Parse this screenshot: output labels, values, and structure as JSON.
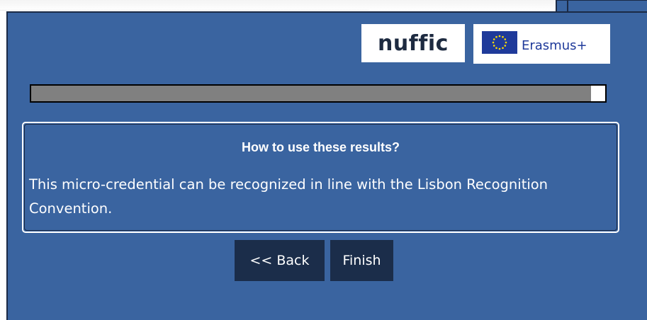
{
  "logos": {
    "nuffic": "nuffic",
    "erasmus": "Erasmus+"
  },
  "progress": {
    "fraction": 0.975,
    "fill_color": "#808080",
    "remaining_color": "#ffffff"
  },
  "results": {
    "title": "How to use these results?",
    "text": "This micro-credential can be recognized in line with the Lisbon Recognition Convention."
  },
  "buttons": {
    "back_label": "<< Back",
    "finish_label": "Finish"
  },
  "colors": {
    "panel_background": "#3a64a0",
    "button_background": "#1b2d4a",
    "eu_blue": "#1f3a9a",
    "eu_star_yellow": "#ffdd00"
  }
}
